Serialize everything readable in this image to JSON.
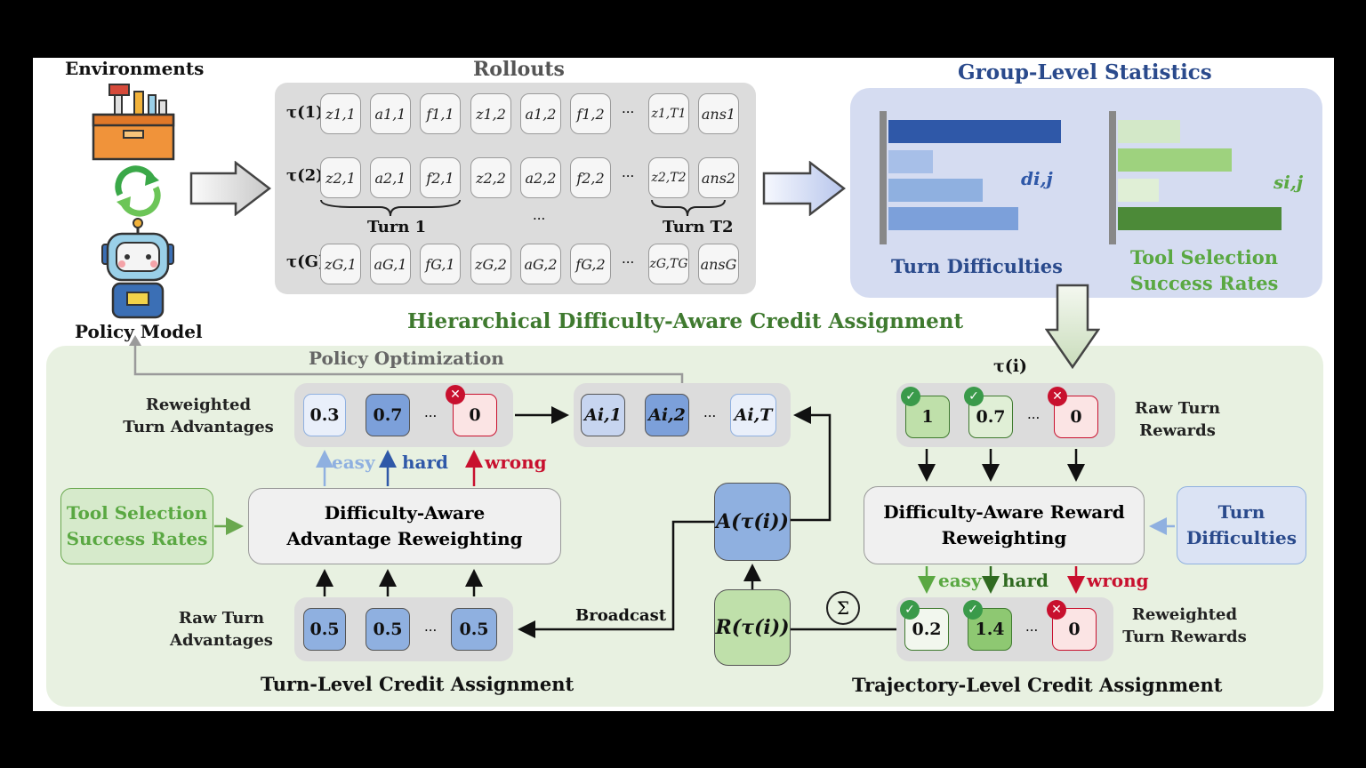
{
  "titles": {
    "environments": "Environments",
    "rollouts": "Rollouts",
    "group_stats": "Group-Level Statistics",
    "policy_model": "Policy Model",
    "hdaca": "Hierarchical Difficulty-Aware Credit Assignment",
    "policy_optimization": "Policy Optimization"
  },
  "rollouts": {
    "rows": [
      {
        "label": "τ(1)",
        "cells": [
          "z1,1",
          "a1,1",
          "f1,1",
          "z1,2",
          "a1,2",
          "f1,2",
          "z1,T1",
          "ans1"
        ]
      },
      {
        "label": "τ(2)",
        "cells": [
          "z2,1",
          "a2,1",
          "f2,1",
          "z2,2",
          "a2,2",
          "f2,2",
          "z2,T2",
          "ans2"
        ]
      },
      {
        "label": "τ(G)",
        "cells": [
          "zG,1",
          "aG,1",
          "fG,1",
          "zG,2",
          "aG,2",
          "fG,2",
          "zG,TG",
          "ansG"
        ]
      }
    ],
    "ellipsis": "···",
    "turn1": "Turn 1",
    "turnT2": "Turn T2"
  },
  "group_stats": {
    "turn_difficulties_label": "Turn Difficulties",
    "d_symbol": "di,j",
    "tool_selection_label_1": "Tool Selection",
    "tool_selection_label_2": "Success Rates",
    "s_symbol": "si,j"
  },
  "turn_level": {
    "title": "Turn-Level Credit Assignment",
    "reweighted_label_1": "Reweighted",
    "reweighted_label_2": "Turn Advantages",
    "reweighted_values": [
      "0.3",
      "0.7",
      "0"
    ],
    "raw_label_1": "Raw Turn",
    "raw_label_2": "Advantages",
    "raw_values": [
      "0.5",
      "0.5",
      "0.5"
    ],
    "advantage_values": [
      "Ai,1",
      "Ai,2",
      "Ai,T"
    ],
    "easy": "easy",
    "hard": "hard",
    "wrong": "wrong",
    "reweighting_box_1": "Difficulty-Aware",
    "reweighting_box_2": "Advantage Reweighting",
    "tool_box_1": "Tool Selection",
    "tool_box_2": "Success Rates",
    "broadcast": "Broadcast",
    "advantage_fn": "A(τ(i))",
    "return_fn": "R(τ(i))",
    "sum_symbol": "Σ"
  },
  "traj_level": {
    "title": "Trajectory-Level Credit Assignment",
    "tau_i": "τ(i)",
    "raw_label_1": "Raw Turn",
    "raw_label_2": "Rewards",
    "raw_values": [
      "1",
      "0.7",
      "0"
    ],
    "reweighted_label_1": "Reweighted",
    "reweighted_label_2": "Turn Rewards",
    "reweighted_values": [
      "0.2",
      "1.4",
      "0"
    ],
    "reweighting_box_1": "Difficulty-Aware Reward",
    "reweighting_box_2": "Reweighting",
    "turn_diff_1": "Turn",
    "turn_diff_2": "Difficulties",
    "easy": "easy",
    "hard": "hard",
    "wrong": "wrong"
  },
  "colors": {
    "green_panel": "#e8f1e1",
    "blue_panel": "#d5dcf1",
    "dark_blue": "#2a4a8c",
    "dark_green": "#3f7a2f",
    "wrong_red": "#c8102e",
    "easy_blue": "#8fb0e0",
    "hard_blue": "#2f58a8"
  }
}
